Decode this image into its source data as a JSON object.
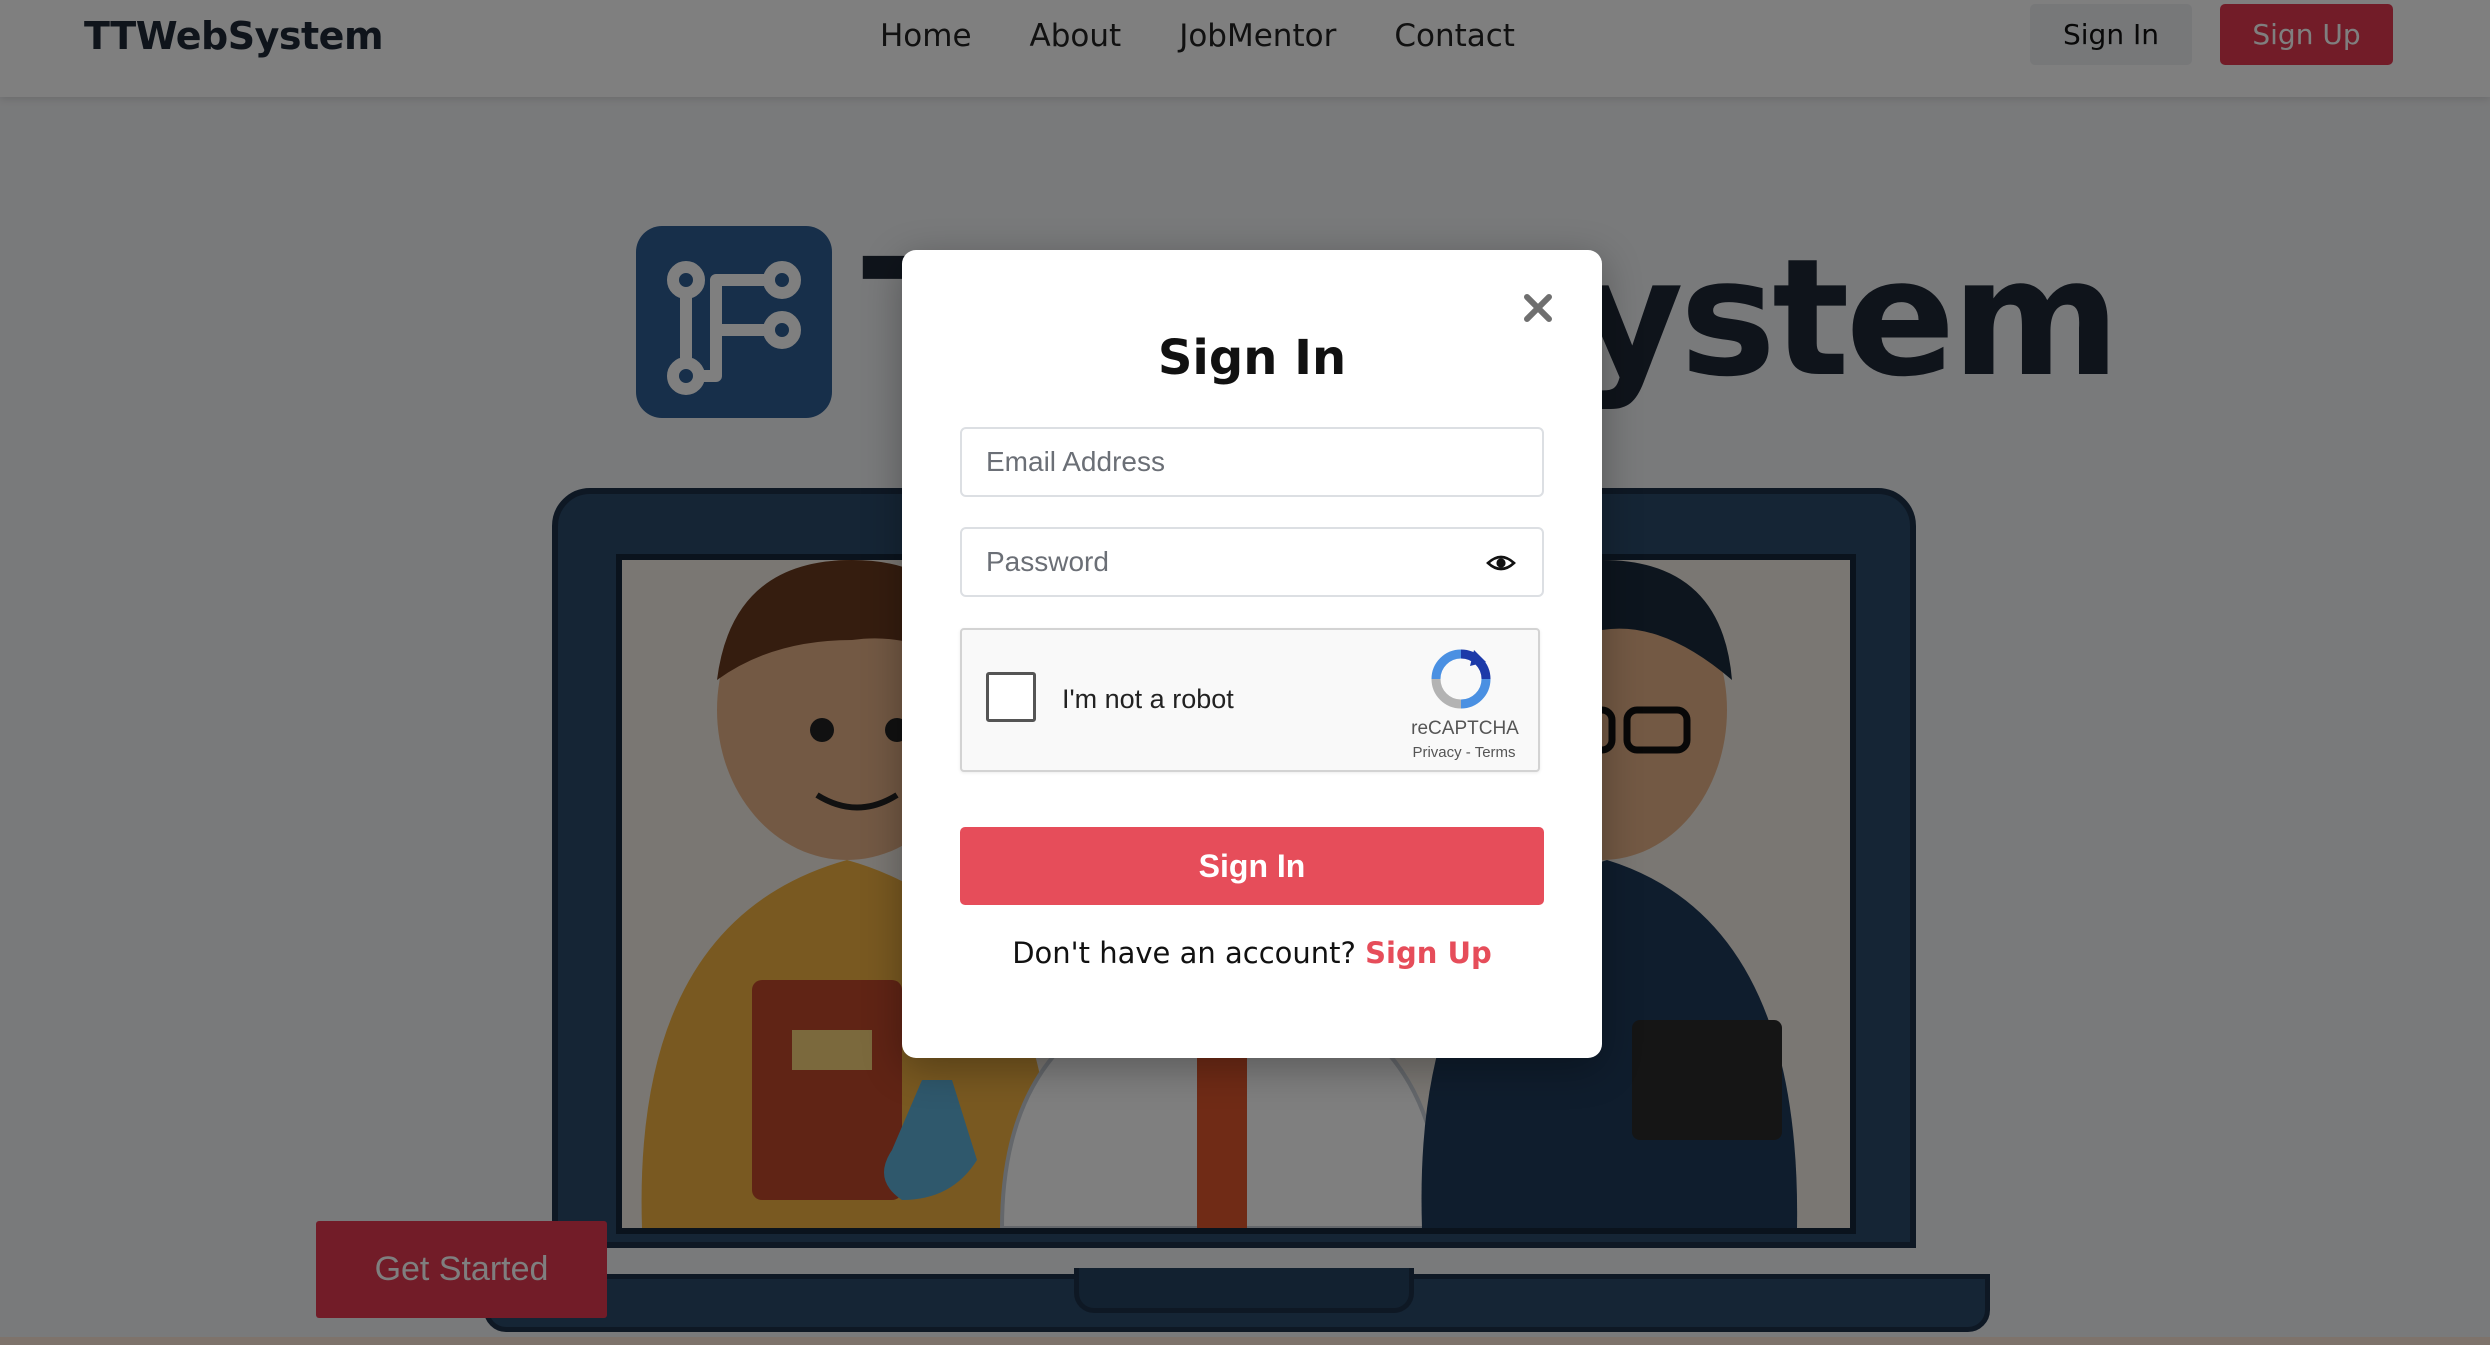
{
  "navbar": {
    "brand": "TTWebSystem",
    "links": [
      "Home",
      "About",
      "JobMentor",
      "Contact"
    ],
    "sign_in_label": "Sign In",
    "sign_up_label": "Sign Up"
  },
  "hero": {
    "title": "TTWebSystem",
    "cta_label": "Get Started"
  },
  "modal": {
    "title": "Sign In",
    "email_placeholder": "Email Address",
    "password_placeholder": "Password",
    "recaptcha": {
      "label": "I'm not a robot",
      "brand": "reCAPTCHA",
      "privacy": "Privacy",
      "separator": " - ",
      "terms": "Terms"
    },
    "submit_label": "Sign In",
    "prompt_text": "Don't have an account?",
    "signup_link": "Sign Up"
  },
  "icons": {
    "close": "close-icon",
    "password_toggle": "eye-icon",
    "recaptcha": "recaptcha-logo-icon",
    "brand_logo": "circuit-logo-icon"
  },
  "colors": {
    "accent": "#e64d5a",
    "nav_signup_bg": "#e53950",
    "logo_bg": "#2e5f95",
    "laptop": "#2a4a6b",
    "overlay": "rgba(0,0,0,0.5)"
  }
}
